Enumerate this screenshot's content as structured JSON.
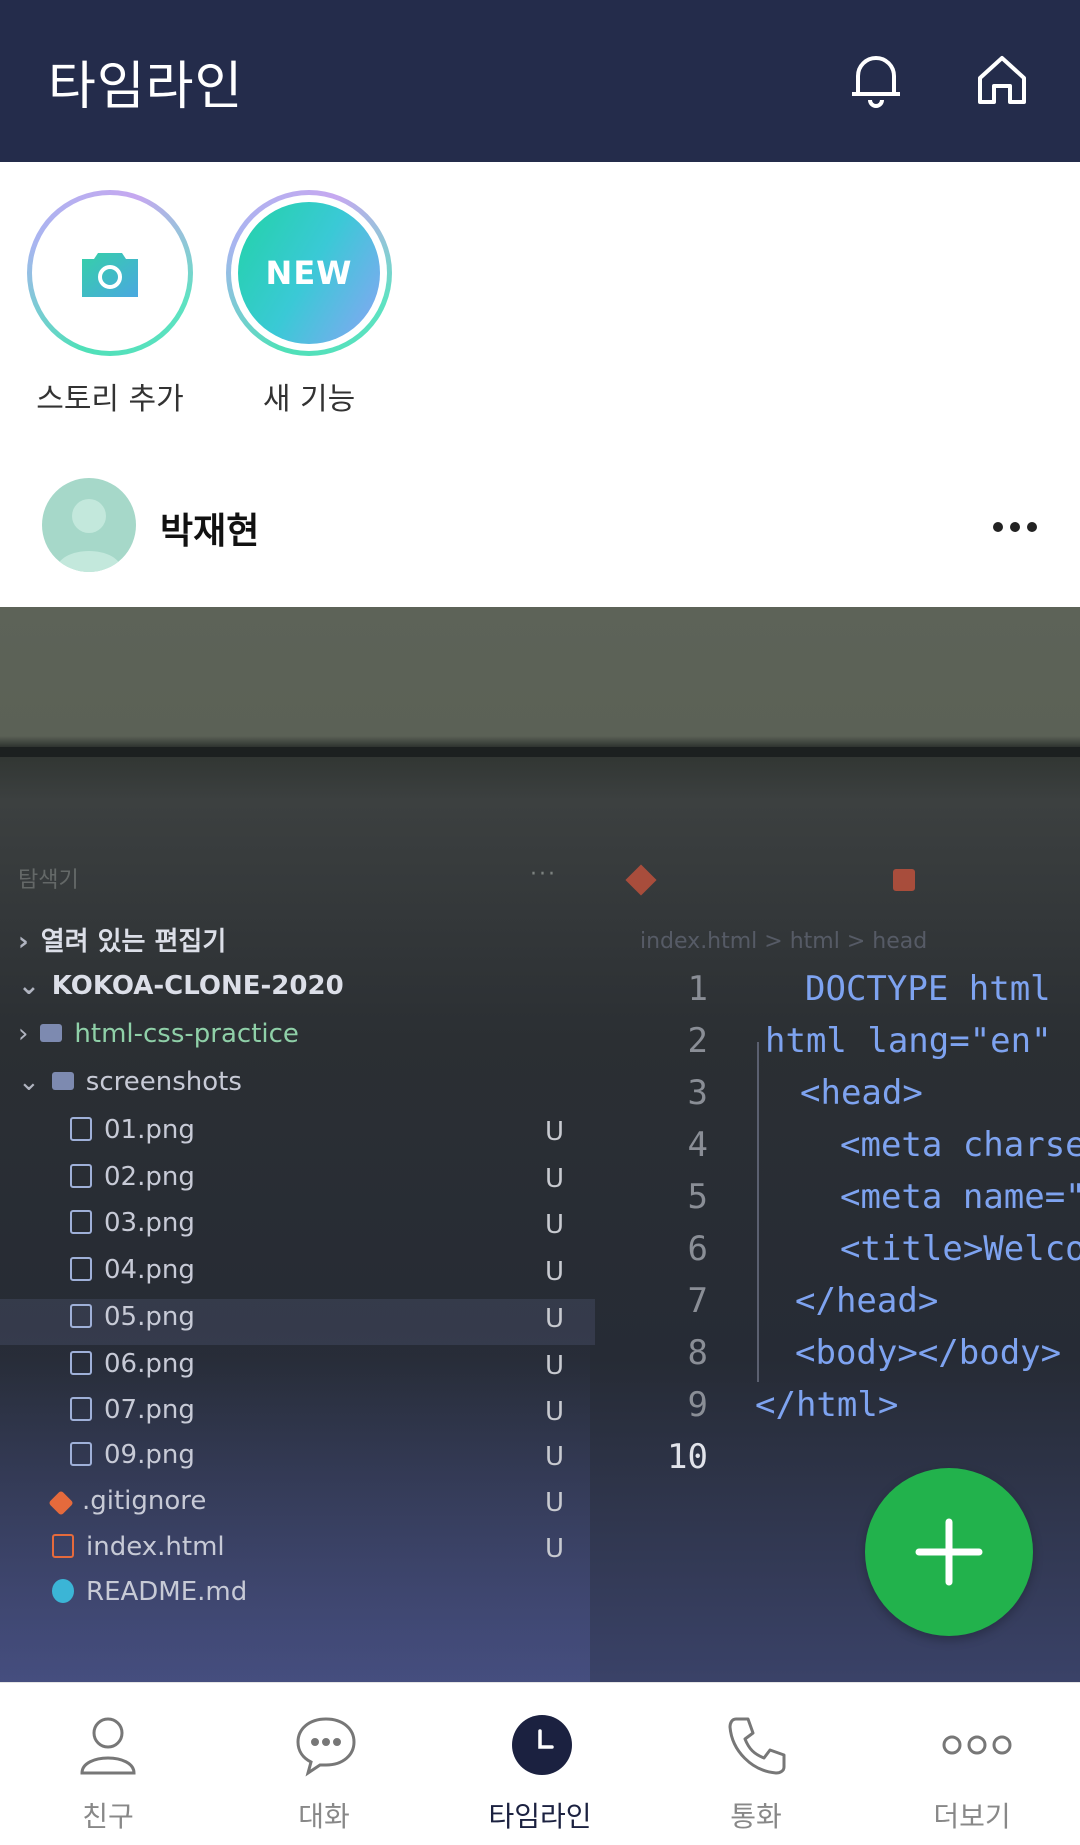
{
  "header": {
    "title": "타임라인",
    "icons": [
      "bell-icon",
      "home-icon"
    ]
  },
  "stories": [
    {
      "label": "스토리 추가",
      "icon": "camera-icon"
    },
    {
      "label": "새 기능",
      "badge": "NEW"
    }
  ],
  "post": {
    "author": "박재현",
    "more_icon": "more-horizontal-icon",
    "image": {
      "explorer_title": "탐색기",
      "open_editors": "열려 있는 편집기",
      "project": "KOKOA-CLONE-2020",
      "breadcrumb": "index.html > html > head",
      "files": [
        {
          "name": "html-css-practice",
          "kind": "folder",
          "status": ""
        },
        {
          "name": "screenshots",
          "kind": "folder-open",
          "status": ""
        },
        {
          "name": "01.png",
          "kind": "image",
          "status": "U"
        },
        {
          "name": "02.png",
          "kind": "image",
          "status": "U"
        },
        {
          "name": "03.png",
          "kind": "image",
          "status": "U"
        },
        {
          "name": "04.png",
          "kind": "image",
          "status": "U"
        },
        {
          "name": "05.png",
          "kind": "image",
          "status": "U"
        },
        {
          "name": "06.png",
          "kind": "image",
          "status": "U"
        },
        {
          "name": "07.png",
          "kind": "image",
          "status": "U"
        },
        {
          "name": "09.png",
          "kind": "image",
          "status": "U"
        },
        {
          "name": ".gitignore",
          "kind": "git",
          "status": "U"
        },
        {
          "name": "index.html",
          "kind": "html",
          "status": "U"
        },
        {
          "name": "README.md",
          "kind": "info",
          "status": ""
        }
      ],
      "line_numbers": [
        "1",
        "2",
        "3",
        "4",
        "5",
        "6",
        "7",
        "8",
        "9",
        "10"
      ],
      "code_lines": [
        "DOCTYPE html",
        "html lang=\"en\"",
        "<head>",
        "<meta charse",
        "<meta name=\"v",
        "<title>Welcom",
        "</head>",
        "<body></body>",
        "</html>"
      ]
    }
  },
  "fab": {
    "icon": "plus-icon"
  },
  "bottom_nav": [
    {
      "label": "친구",
      "icon": "person-icon",
      "active": false
    },
    {
      "label": "대화",
      "icon": "chat-bubble-icon",
      "active": false
    },
    {
      "label": "타임라인",
      "icon": "clock-icon",
      "active": true
    },
    {
      "label": "통화",
      "icon": "phone-icon",
      "active": false
    },
    {
      "label": "더보기",
      "icon": "more-dots-icon",
      "active": false
    }
  ],
  "colors": {
    "header_bg": "#242c4b",
    "fab": "#22b24c",
    "active_nav": "#1b2140"
  }
}
